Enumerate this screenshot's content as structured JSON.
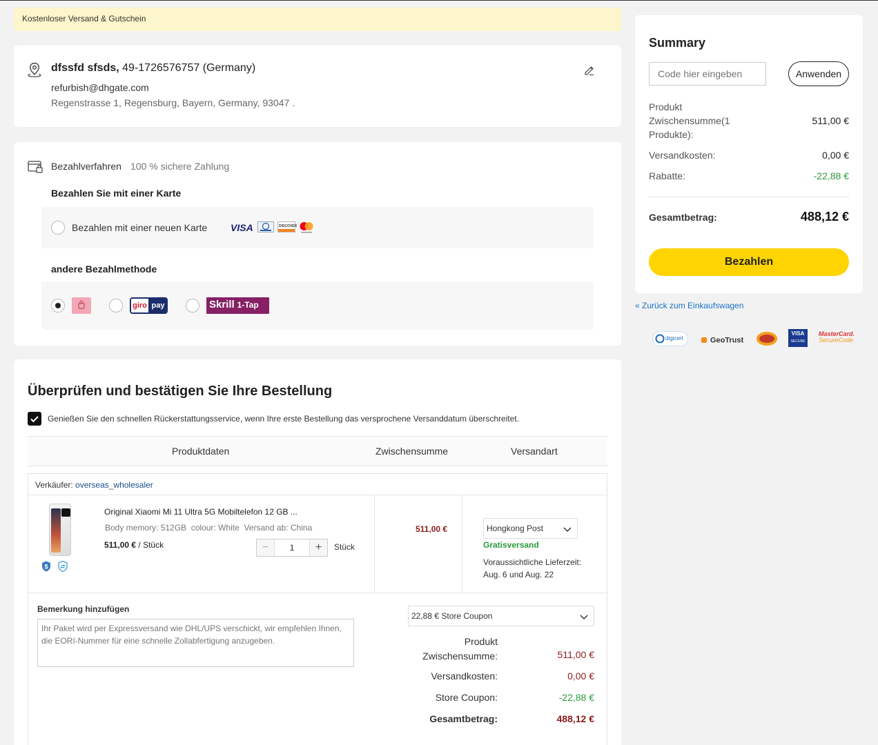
{
  "notice": "Kostenloser Versand & Gutschein",
  "address": {
    "name": "dfssfd sfsds,",
    "phone": "49-1726576757 (Germany)",
    "email": "refurbish@dhgate.com",
    "street": "Regenstrasse 1, Regensburg, Bayern, Germany, 93047 ."
  },
  "payment": {
    "title": "Bezahlverfahren",
    "secure": "100 % sichere Zahlung",
    "card_section": "Bezahlen Sie mit einer Karte",
    "new_card": "Bezahlen mit einer neuen Karte",
    "other_section": "andere Bezahlmethode",
    "giropay_a": "giro",
    "giropay_b": "pay",
    "skrill_a": "Skrill",
    "skrill_b": "1-Tap"
  },
  "review": {
    "title": "Überprüfen und bestätigen Sie Ihre Bestellung",
    "refund_text": "Genießen Sie den schnellen Rückerstattungsservice, wenn Ihre erste Bestellung das versprochene Versanddatum überschreitet.",
    "columns": [
      "Produktdaten",
      "Zwischensumme",
      "Versandart"
    ],
    "seller_label": "Verkäufer:",
    "seller_name": "overseas_wholesaler",
    "product": {
      "name": "Original Xiaomi Mi 11 Ultra 5G Mobiltelefon 12 GB ...",
      "attr_memory_label": "Body memory:",
      "attr_memory": "512GB",
      "attr_colour_label": "colour:",
      "attr_colour": "White",
      "attr_ship_label": "Versand ab:",
      "attr_ship": "China",
      "price": "511,00 €",
      "price_unit": "/ Stück",
      "quantity": "1",
      "unit": "Stück",
      "subtotal": "511,00 €"
    },
    "shipping": {
      "method": "Hongkong Post",
      "free": "Gratisversand",
      "eta_label": "Voraussichtliche Lieferzeit:",
      "eta": "Aug. 6 und Aug. 22"
    },
    "remark_label": "Bemerkung hinzufügen",
    "remark_placeholder": "Ihr Paket wird per Expressversand wie DHL/UPS verschickt, wir empfehlen Ihnen, die EORI-Nummer für eine schnelle Zollabfertigung anzugeben.",
    "coupon": "22,88 € Store Coupon",
    "totals": {
      "product_label_1": "Produkt",
      "product_label_2": "Zwischensumme:",
      "product_value": "511,00 €",
      "shipping_label": "Versandkosten:",
      "shipping_value": "0,00 €",
      "coupon_label": "Store Coupon:",
      "coupon_value": "-22,88 €",
      "total_label": "Gesamtbetrag:",
      "total_value": "488,12 €"
    }
  },
  "summary": {
    "title": "Summary",
    "code_placeholder": "Code hier eingeben",
    "apply": "Anwenden",
    "product_label": "Produkt Zwischensumme(1 Produkte):",
    "product_value": "511,00 €",
    "shipping_label": "Versandkosten:",
    "shipping_value": "0,00 €",
    "discount_label": "Rabatte:",
    "discount_value": "-22,88 €",
    "total_label": "Gesamtbetrag:",
    "total_value": "488,12 €",
    "pay_button": "Bezahlen"
  },
  "back_link": "« Zurück zum Einkaufswagen",
  "trust": {
    "digicert": "digicert",
    "geotrust": "GeoTrust",
    "visa": "VISA",
    "visa_secure": "SECURE",
    "mc_a": "MasterCard.",
    "mc_b": "SecureCode"
  },
  "card_logos": {
    "visa": "VISA",
    "discover": "DISCOVER"
  },
  "colors": {
    "accent_yellow": "#ffd400",
    "price_red": "#8b1b1b",
    "green": "#2a9b3b",
    "link_blue": "#1a73c8"
  }
}
